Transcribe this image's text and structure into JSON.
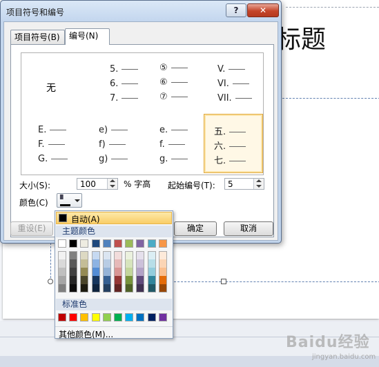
{
  "dialog": {
    "title": "项目符号和编号",
    "help_label": "?",
    "close_label": "✕",
    "tabs": [
      {
        "label": "项目符号(B)"
      },
      {
        "label": "编号(N)"
      }
    ],
    "gallery": {
      "none_label": "无",
      "cells": [
        [
          "5.",
          "6.",
          "7."
        ],
        [
          "⑤",
          "⑥",
          "⑦"
        ],
        [
          "V.",
          "VI.",
          "VII."
        ],
        [
          "E.",
          "F.",
          "G."
        ],
        [
          "e)",
          "f)",
          "g)"
        ],
        [
          "e.",
          "f.",
          "g."
        ],
        [
          "五.",
          "六.",
          "七."
        ]
      ],
      "selected_index": 7
    },
    "size": {
      "label": "大小(S):",
      "value": "100",
      "unit": "% 字高"
    },
    "start": {
      "label": "起始编号(T):",
      "value": "5"
    },
    "color": {
      "label": "颜色(C)",
      "current": "#000000"
    },
    "buttons": {
      "reset": "重设(E)",
      "ok": "确定",
      "cancel": "取消"
    }
  },
  "color_menu": {
    "auto_label": "自动(A)",
    "theme_header": "主题颜色",
    "standard_header": "标准色",
    "more_label": "其他颜色(M)...",
    "theme_top": [
      "#ffffff",
      "#000000",
      "#eeece1",
      "#1f497d",
      "#4f81bd",
      "#c0504d",
      "#9bbb59",
      "#8064a2",
      "#4bacc6",
      "#f79646"
    ],
    "theme_shades": [
      [
        "#f2f2f2",
        "#d9d9d9",
        "#bfbfbf",
        "#a6a6a6",
        "#808080"
      ],
      [
        "#808080",
        "#595959",
        "#404040",
        "#262626",
        "#0d0d0d"
      ],
      [
        "#ddd9c3",
        "#c4bd97",
        "#948a54",
        "#4a452a",
        "#1d1b10"
      ],
      [
        "#c6d9f1",
        "#8db3e2",
        "#548dd4",
        "#17365d",
        "#0f243e"
      ],
      [
        "#dbe5f1",
        "#b8cce4",
        "#95b3d7",
        "#366092",
        "#244061"
      ],
      [
        "#f2dcdb",
        "#e6b9b8",
        "#d99694",
        "#953735",
        "#632523"
      ],
      [
        "#ebf1de",
        "#d7e4bd",
        "#c3d69b",
        "#77933c",
        "#4f6228"
      ],
      [
        "#e5e0ec",
        "#ccc1da",
        "#b3a2c7",
        "#604a7b",
        "#403152"
      ],
      [
        "#dbeef4",
        "#b7dee8",
        "#93cddd",
        "#31859c",
        "#215968"
      ],
      [
        "#fdeada",
        "#fbd5b5",
        "#fac090",
        "#e46c0a",
        "#984807"
      ]
    ],
    "standard": [
      "#c00000",
      "#ff0000",
      "#ffc000",
      "#ffff00",
      "#92d050",
      "#00b050",
      "#00b0f0",
      "#0070c0",
      "#002060",
      "#7030a0"
    ]
  },
  "slide": {
    "title_fragment": "标题"
  },
  "watermark": {
    "brand": "Baidu经验",
    "url": "jingyan.baidu.com"
  }
}
